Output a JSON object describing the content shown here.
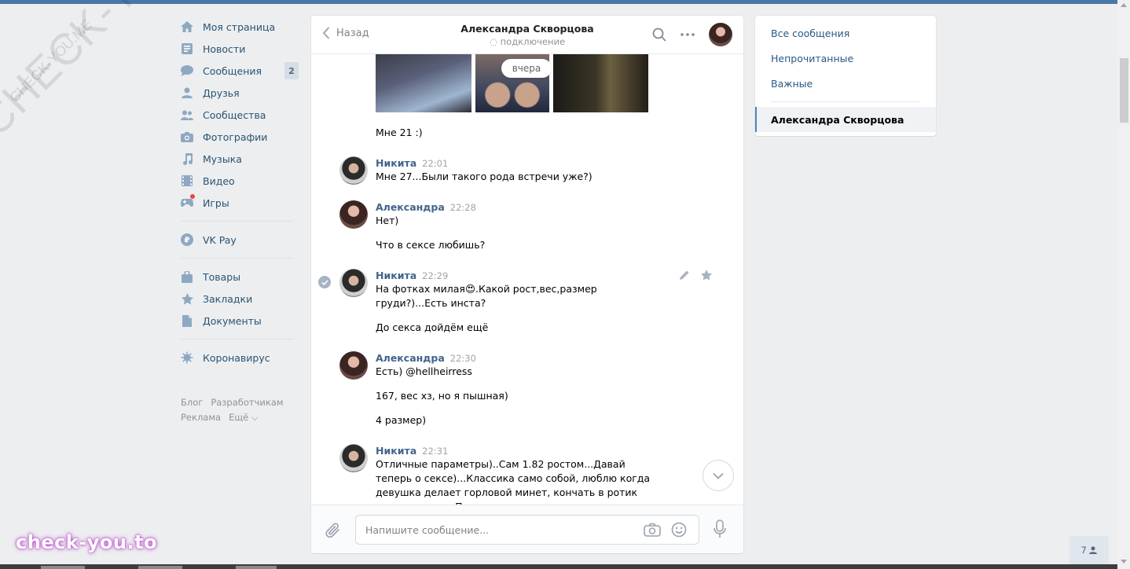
{
  "watermarks": {
    "diagonal_big": "CHECK-YOU.ME",
    "diagonal_small": "CHECK-YOU.ME",
    "logo": "check-you.to"
  },
  "leftnav": {
    "items": [
      {
        "label": "Моя страница",
        "icon": "home-icon"
      },
      {
        "label": "Новости",
        "icon": "news-icon"
      },
      {
        "label": "Сообщения",
        "icon": "messages-icon",
        "badge": "2"
      },
      {
        "label": "Друзья",
        "icon": "friends-icon"
      },
      {
        "label": "Сообщества",
        "icon": "groups-icon"
      },
      {
        "label": "Фотографии",
        "icon": "photos-icon"
      },
      {
        "label": "Музыка",
        "icon": "music-icon"
      },
      {
        "label": "Видео",
        "icon": "video-icon"
      },
      {
        "label": "Игры",
        "icon": "games-icon"
      }
    ],
    "group2": [
      {
        "label": "VK Pay",
        "icon": "vkpay-icon"
      }
    ],
    "group3": [
      {
        "label": "Товары",
        "icon": "market-icon"
      },
      {
        "label": "Закладки",
        "icon": "bookmarks-icon"
      },
      {
        "label": "Документы",
        "icon": "documents-icon"
      }
    ],
    "group4": [
      {
        "label": "Коронавирус",
        "icon": "coronavirus-icon"
      }
    ],
    "footer": {
      "blog": "Блог",
      "dev": "Разработчикам",
      "ads": "Реклама",
      "more": "Ещё ⌵"
    }
  },
  "chat": {
    "back_label": "Назад",
    "title": "Александра Скворцова",
    "status": "подключение",
    "date_pill": "вчера",
    "first_text": "Мне 21 :)",
    "messages": [
      {
        "author": "Никита",
        "time": "22:01",
        "lines": [
          "Мне 27...Были такого рода встречи уже?)"
        ]
      },
      {
        "author": "Александра",
        "time": "22:28",
        "lines": [
          "Нет)",
          "Что в сексе любишь?"
        ]
      },
      {
        "author": "Никита",
        "time": "22:29",
        "lines": [
          "На фотках милая😍.Какой рост,вес,размер груди?)...Есть инста?",
          "До секса дойдём ещё"
        ]
      },
      {
        "author": "Александра",
        "time": "22:30",
        "lines": [
          "Есть) @hellheirress",
          "167, вес хз, но я пышная)",
          "4 размер)"
        ]
      },
      {
        "author": "Никита",
        "time": "22:31",
        "lines": [
          "Отличные параметры)..Сам 1.82 ростом...Давай теперь о сексе)...Классика само собой, люблю когда девушка делает горловой минет, кончать в ротик предпочитаю...Приятно"
        ]
      }
    ],
    "composer": {
      "placeholder": "Напишите сообщение..."
    }
  },
  "rightmenu": {
    "items": [
      "Все сообщения",
      "Непрочитанные",
      "Важные"
    ],
    "active": "Александра Скворцова"
  },
  "online_counter": "7"
}
